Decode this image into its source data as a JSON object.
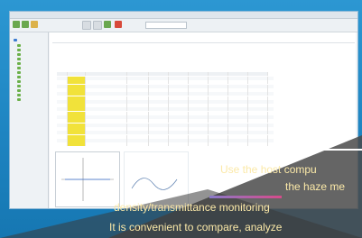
{
  "caption": {
    "line1": "Use the host compu",
    "line2": "the haze me",
    "line3": "density/transmittance monitoring",
    "line4": "It is convenient to compare, analyze"
  },
  "colors": {
    "background": "#1f86c2",
    "highlight_rows": "#f1e23a",
    "caption_text": "#fbe9a8",
    "tree_icons": "#6bb04a"
  }
}
